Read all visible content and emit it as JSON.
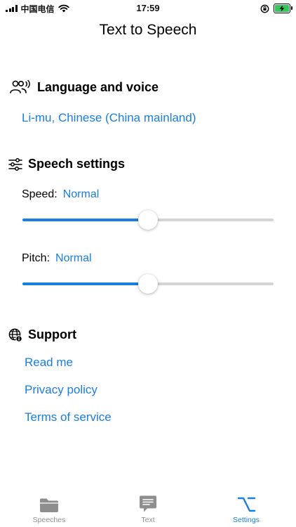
{
  "status_bar": {
    "carrier": "中国电信",
    "time": "17:59"
  },
  "nav": {
    "title": "Text to Speech"
  },
  "language_section": {
    "title": "Language and voice",
    "voice": "Li-mu, Chinese (China mainland)"
  },
  "speech_section": {
    "title": "Speech settings",
    "speed": {
      "label": "Speed:",
      "value": "Normal",
      "level": 0.5
    },
    "pitch": {
      "label": "Pitch:",
      "value": "Normal",
      "level": 0.5
    }
  },
  "support_section": {
    "title": "Support",
    "links": [
      {
        "label": "Read me"
      },
      {
        "label": "Privacy policy"
      },
      {
        "label": "Terms of service"
      }
    ]
  },
  "tab_bar": {
    "tabs": [
      {
        "label": "Speeches",
        "icon": "folder-icon",
        "active": false
      },
      {
        "label": "Text",
        "icon": "text-bubble-icon",
        "active": false
      },
      {
        "label": "Settings",
        "icon": "option-key-icon",
        "active": true
      }
    ]
  },
  "colors": {
    "accent": "#1a7ee0",
    "battery": "#34c759",
    "inactive_tab": "#8e8e8e",
    "track": "#d4d4d4"
  }
}
